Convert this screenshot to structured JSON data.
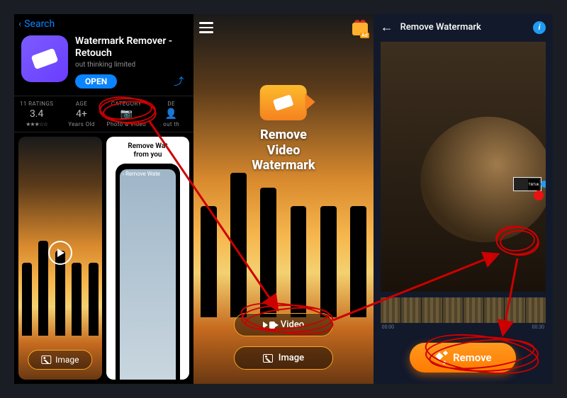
{
  "appstore": {
    "back_label": "Search",
    "title": "Watermark Remover - Retouch",
    "developer": "out thinking limited",
    "open_label": "OPEN",
    "stats": {
      "ratings_header": "11 RATINGS",
      "ratings_value": "3.4",
      "ratings_stars": "★★★☆☆",
      "age_header": "AGE",
      "age_value": "4+",
      "age_sub": "Years Old",
      "category_header": "CATEGORY",
      "category_value": "📷",
      "category_sub": "Photo & Video",
      "dev_header": "DE",
      "dev_sub": "out th"
    },
    "preview": {
      "image_label": "Image",
      "promo_line1": "Remove Wat",
      "promo_line2": "from you",
      "promo_tab": "Remove Wate"
    }
  },
  "home": {
    "ad_badge": "Ad",
    "logo_line1": "Remove",
    "logo_line2": "Video Watermark",
    "video_label": "Video",
    "image_label": "Image"
  },
  "editor": {
    "title": "Remove Watermark",
    "tiktok_label": "TikTok",
    "time_start": "00:00",
    "time_end": "00:30",
    "remove_label": "Remove"
  }
}
